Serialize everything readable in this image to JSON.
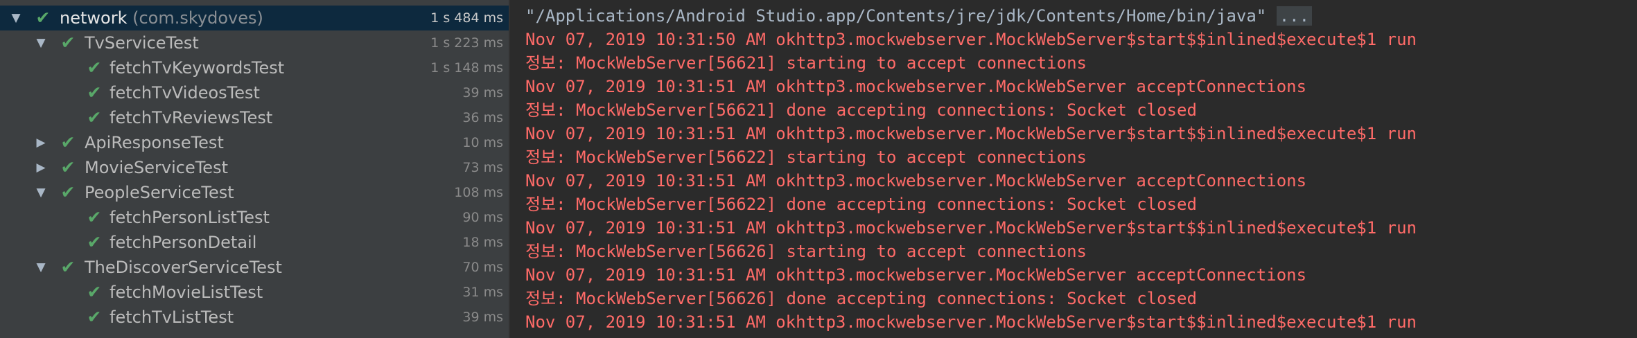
{
  "tree": {
    "root": {
      "label": "network",
      "package": "(com.skydoves)",
      "time": "1 s 484 ms"
    },
    "items": [
      {
        "label": "TvServiceTest",
        "time": "1 s 223 ms"
      },
      {
        "label": "fetchTvKeywordsTest",
        "time": "1 s 148 ms"
      },
      {
        "label": "fetchTvVideosTest",
        "time": "39 ms"
      },
      {
        "label": "fetchTvReviewsTest",
        "time": "36 ms"
      },
      {
        "label": "ApiResponseTest",
        "time": "10 ms"
      },
      {
        "label": "MovieServiceTest",
        "time": "73 ms"
      },
      {
        "label": "PeopleServiceTest",
        "time": "108 ms"
      },
      {
        "label": "fetchPersonListTest",
        "time": "90 ms"
      },
      {
        "label": "fetchPersonDetail",
        "time": "18 ms"
      },
      {
        "label": "TheDiscoverServiceTest",
        "time": "70 ms"
      },
      {
        "label": "fetchMovieListTest",
        "time": "31 ms"
      },
      {
        "label": "fetchTvListTest",
        "time": "39 ms"
      }
    ],
    "icons": {
      "expanded": "triangle-down-icon",
      "collapsed": "triangle-right-icon",
      "passed": "check-icon"
    }
  },
  "console": {
    "command": "\"/Applications/Android Studio.app/Contents/jre/jdk/Contents/Home/bin/java\"",
    "command_more": "...",
    "lines": [
      "Nov 07, 2019 10:31:50 AM okhttp3.mockwebserver.MockWebServer$start$$inlined$execute$1 run",
      "정보: MockWebServer[56621] starting to accept connections",
      "Nov 07, 2019 10:31:51 AM okhttp3.mockwebserver.MockWebServer acceptConnections",
      "정보: MockWebServer[56621] done accepting connections: Socket closed",
      "Nov 07, 2019 10:31:51 AM okhttp3.mockwebserver.MockWebServer$start$$inlined$execute$1 run",
      "정보: MockWebServer[56622] starting to accept connections",
      "Nov 07, 2019 10:31:51 AM okhttp3.mockwebserver.MockWebServer acceptConnections",
      "정보: MockWebServer[56622] done accepting connections: Socket closed",
      "Nov 07, 2019 10:31:51 AM okhttp3.mockwebserver.MockWebServer$start$$inlined$execute$1 run",
      "정보: MockWebServer[56626] starting to accept connections",
      "Nov 07, 2019 10:31:51 AM okhttp3.mockwebserver.MockWebServer acceptConnections",
      "정보: MockWebServer[56626] done accepting connections: Socket closed",
      "Nov 07, 2019 10:31:51 AM okhttp3.mockwebserver.MockWebServer$start$$inlined$execute$1 run"
    ]
  },
  "colors": {
    "tree_background": "#3c3f41",
    "selected_row": "#0d293e",
    "console_background": "#2b2b2b",
    "error_text": "#ff6b68",
    "pass_check": "#59a869"
  }
}
